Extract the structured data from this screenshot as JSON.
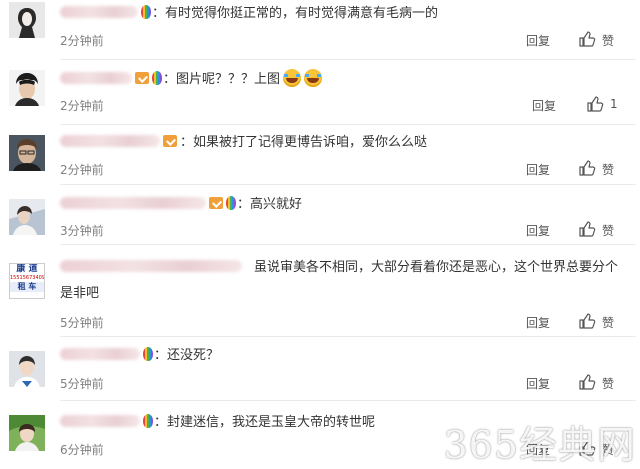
{
  "comments": [
    {
      "text": "：有时觉得你挺正常的，有时觉得满意有毛病一的",
      "time": "2分钟前",
      "reply": "回复",
      "like": "赞"
    },
    {
      "text": "：图片呢？？？上图",
      "time": "2分钟前",
      "reply": "回复",
      "like": "1"
    },
    {
      "text": "：如果被打了记得更博告诉咱，爱你么么哒",
      "time": "2分钟前",
      "reply": "回复",
      "like": "赞"
    },
    {
      "text": "：高兴就好",
      "time": "3分钟前",
      "reply": "回复",
      "like": "赞"
    },
    {
      "text": "虽说审美各不相同，大部分看着你还是恶心，这个世界总要分个是非吧",
      "time": "5分钟前",
      "reply": "回复",
      "like": "赞",
      "avatar_text": {
        "top": "康 道",
        "mid": "15515673409",
        "bottom": "租 车"
      }
    },
    {
      "text": "：还没死？",
      "time": "5分钟前",
      "reply": "回复",
      "like": "赞"
    },
    {
      "text": "：封建迷信，我还是玉皇大帝的转世呢",
      "time": "6分钟前",
      "reply": "回复",
      "like": "赞"
    }
  ],
  "watermark": "365经典网",
  "colors": {
    "text": "#333333",
    "time": "#808080",
    "divider": "#eaeaea"
  },
  "icons": {
    "like": "thumb-up-icon",
    "badge": "vip-icon",
    "balloon": "balloon-icon",
    "emoji": "laughing-emoji-icon"
  }
}
